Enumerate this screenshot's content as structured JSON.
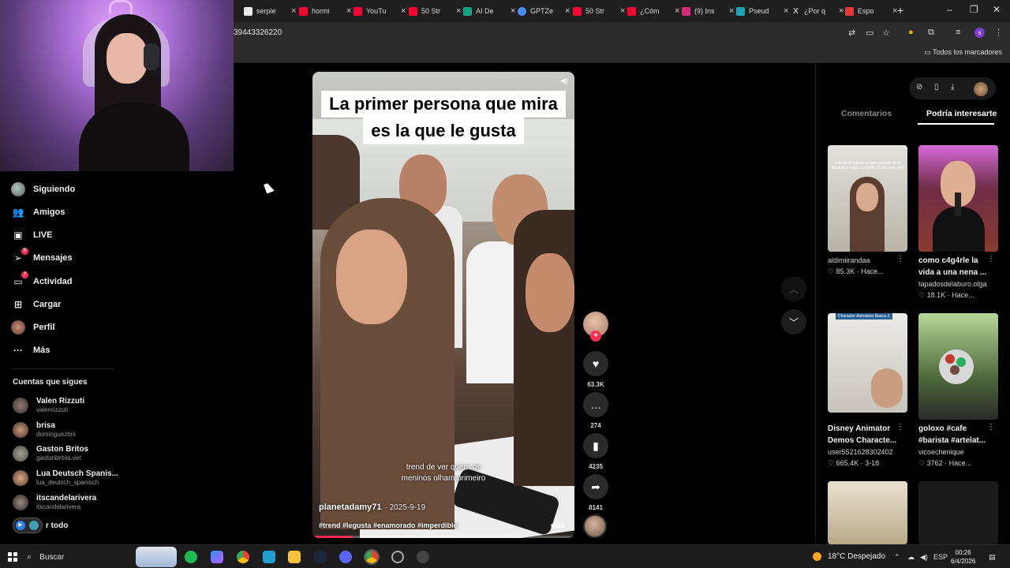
{
  "browser": {
    "tabs": [
      {
        "label": "serpie",
        "color": "#e8e8e8"
      },
      {
        "label": "hormi",
        "color": "#ff0033"
      },
      {
        "label": "YouTu",
        "color": "#ff0033"
      },
      {
        "label": "50 Str",
        "color": "#ff0033"
      },
      {
        "label": "AI De",
        "color": "#10a37f"
      },
      {
        "label": "GPTZe",
        "color": "#4c8bf5"
      },
      {
        "label": "50 Str",
        "color": "#ff0033"
      },
      {
        "label": "¿Cóm",
        "color": "#ff0033"
      },
      {
        "label": "(9) Ins",
        "color": "#d62976"
      },
      {
        "label": "Pseud",
        "color": "#1aa6b7"
      },
      {
        "label": "¿Por q",
        "color": "#ffffff"
      },
      {
        "label": "Espo",
        "color": "#e53935"
      }
    ],
    "url": "39443326220",
    "bookmarks_all": "Todos los marcadores",
    "profile_initial": "s"
  },
  "sidebar": {
    "items": [
      {
        "label": "Siguiendo",
        "icon": "following-avatar-icon"
      },
      {
        "label": "Amigos",
        "icon": "friends-icon"
      },
      {
        "label": "LIVE",
        "icon": "live-icon"
      },
      {
        "label": "Mensajes",
        "icon": "messages-icon",
        "badge": "5"
      },
      {
        "label": "Actividad",
        "icon": "activity-icon",
        "badge": "7"
      },
      {
        "label": "Cargar",
        "icon": "upload-icon"
      },
      {
        "label": "Perfil",
        "icon": "profile-avatar-icon"
      },
      {
        "label": "Más",
        "icon": "more-icon"
      }
    ],
    "following_title": "Cuentas que sigues",
    "accounts": [
      {
        "name": "Valen Rizzuti",
        "handle": "valenrizzuti"
      },
      {
        "name": "brisa",
        "handle": "dominguezbrii"
      },
      {
        "name": "Gaston Britos",
        "handle": "gastonbritos.vet"
      },
      {
        "name": "Lua Deutsch Spanis...",
        "handle": "lua_deutsch_spanisch"
      },
      {
        "name": "itscandelarivera",
        "handle": "itscandelarivera"
      }
    ],
    "see_all": "r todo"
  },
  "video": {
    "caption_line1": "La primer persona que mira",
    "caption_line2": "es la que le gusta",
    "subtitle_line1": "trend de ver quem os",
    "subtitle_line2": "meninos olham primeiro",
    "author": "planetadamy71",
    "date": "· 2025-9-19",
    "tags": "#trend #legusta #enamorado #imperdible",
    "more": "más",
    "progress": 0.15
  },
  "actions": {
    "likes": "63.3K",
    "comments": "274",
    "saves": "4235",
    "shares": "8141"
  },
  "right_panel": {
    "tab_comments": "Comentarios",
    "tab_suggested": "Podría interesarte",
    "cards": [
      {
        "title": "",
        "user": "aldimiirandaa",
        "stats": "♡ 85.3K · Hace...",
        "thumb_text": "cuando te haces amigas nuevas en la facultad y todas cumplen 19 años de vida"
      },
      {
        "title": "como c4g4rle la",
        "title2": "vida a una nena ...",
        "user": "tapadosdelaburo.olga",
        "stats": "♡ 18.1K · Hace..."
      },
      {
        "title": "Disney Animator",
        "title2": "Demos Characte...",
        "user": "user5521628302402",
        "stats": "♡ 665.4K · 3-18",
        "thumb_label": "Character Animation Basics 2"
      },
      {
        "title": "goloxo #cafe",
        "title2": "#barista #artelat...",
        "user": "vicoechenique",
        "stats": "♡ 3762 · Hace..."
      }
    ]
  },
  "taskbar": {
    "search": "Buscar",
    "weather": "18°C  Despejado",
    "lang": "ESP",
    "time": "00:26",
    "date": "6/4/2026"
  }
}
